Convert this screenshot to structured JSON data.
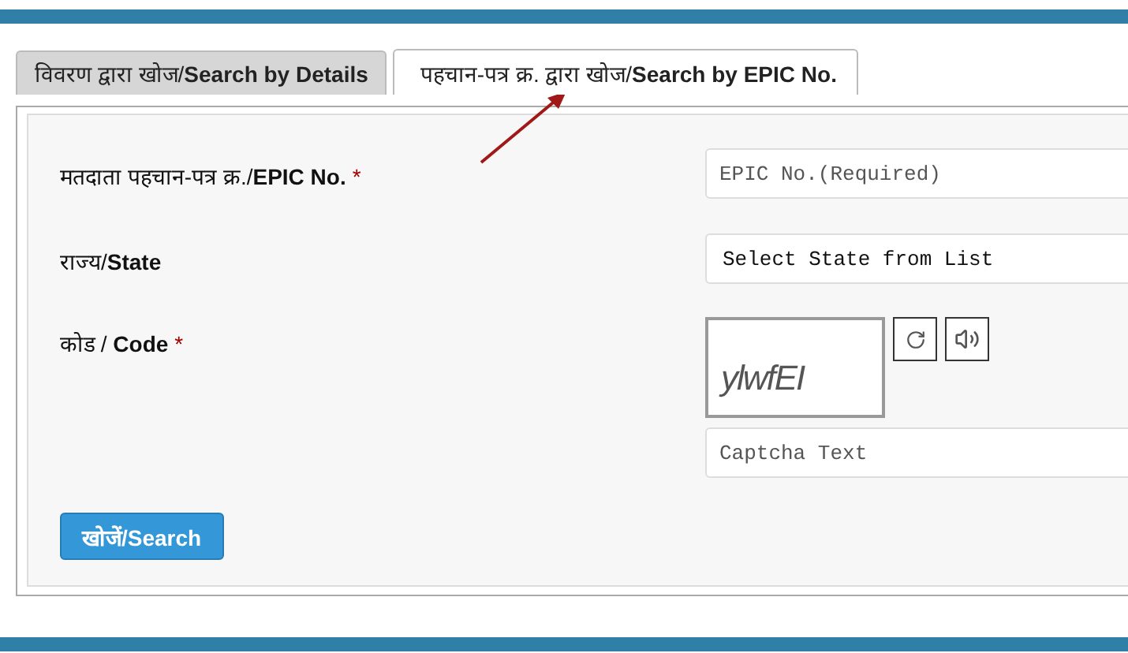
{
  "tabs": [
    {
      "label": "विवरण द्वारा खोज/**Search by Details**",
      "selected": false
    },
    {
      "label": "पहचान-पत्र क्र. द्वारा खोज/**Search by EPIC No.**",
      "selected": true
    }
  ],
  "form": {
    "required_mark": "*",
    "fields": [
      {
        "kind": "text",
        "label": "मतदाता पहचान-पत्र क्र./**EPIC No.**",
        "required": true,
        "placeholder": "EPIC No.(Required)"
      },
      {
        "kind": "select",
        "label": "राज्य/**State**",
        "required": false,
        "value": "Select State from List"
      },
      {
        "kind": "captcha",
        "label": "कोड / **Code**",
        "required": true,
        "captcha": "ylwfEI",
        "placeholder": "Captcha Text"
      }
    ],
    "submit": "खोजें/Search"
  }
}
